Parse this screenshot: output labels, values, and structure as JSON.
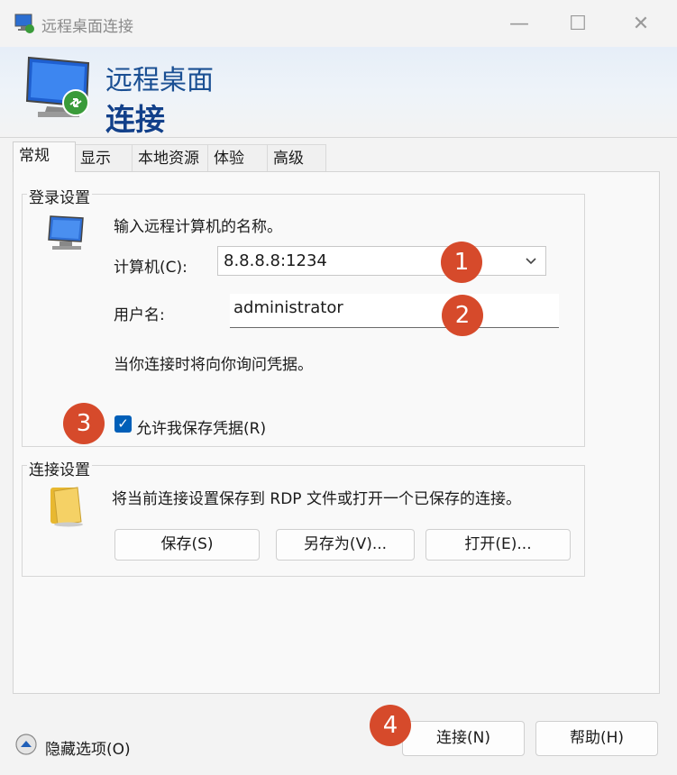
{
  "window": {
    "title": "远程桌面连接",
    "controls": {
      "minimize": "—",
      "maximize": "☐",
      "close": "✕"
    }
  },
  "banner": {
    "line1": "远程桌面",
    "line2": "连接"
  },
  "tabs": [
    {
      "label": "常规",
      "active": true
    },
    {
      "label": "显示"
    },
    {
      "label": "本地资源"
    },
    {
      "label": "体验"
    },
    {
      "label": "高级"
    }
  ],
  "login": {
    "title": "登录设置",
    "prompt": "输入远程计算机的名称。",
    "computer_label": "计算机(C):",
    "computer_value": "8.8.8.8:1234",
    "username_label": "用户名:",
    "username_value": "administrator",
    "credentials_note": "当你连接时将向你询问凭据。",
    "allow_save_label": "允许我保存凭据(R)",
    "allow_save_checked": true
  },
  "connection": {
    "title": "连接设置",
    "description": "将当前连接设置保存到 RDP 文件或打开一个已保存的连接。",
    "save_label": "保存(S)",
    "save_as_label": "另存为(V)...",
    "open_label": "打开(E)..."
  },
  "footer": {
    "hide_options_label": "隐藏选项(O)",
    "connect_label": "连接(N)",
    "help_label": "帮助(H)"
  },
  "annotations": [
    "1",
    "2",
    "3",
    "4"
  ],
  "colors": {
    "accent": "#005fb8",
    "badge": "#d64a2b",
    "banner_text": "#1a4f93"
  }
}
